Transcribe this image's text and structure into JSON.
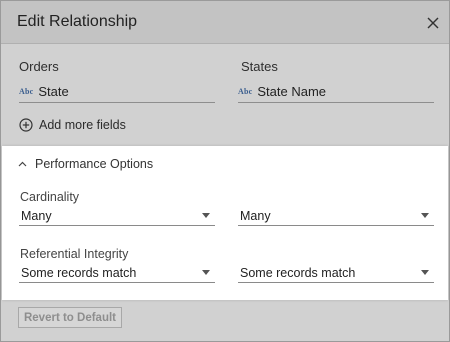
{
  "dialog": {
    "title": "Edit Relationship",
    "close_icon": "close-icon"
  },
  "fields": {
    "left_table": "Orders",
    "right_table": "States",
    "left_field": {
      "type_badge": "Abc",
      "name": "State"
    },
    "right_field": {
      "type_badge": "Abc",
      "name": "State Name"
    },
    "add_more_label": "Add more fields",
    "add_more_icon": "plus-circle-icon"
  },
  "performance": {
    "header_label": "Performance Options",
    "header_icon": "chevron-up-icon",
    "cardinality_label": "Cardinality",
    "cardinality_left": "Many",
    "cardinality_right": "Many",
    "integrity_label": "Referential Integrity",
    "integrity_left": "Some records match",
    "integrity_right": "Some records match"
  },
  "footer": {
    "revert_label": "Revert to Default"
  },
  "colors": {
    "dialog_bg": "#d1d1d1",
    "panel_bg": "#ffffff",
    "type_badge": "#3c5f8f"
  }
}
